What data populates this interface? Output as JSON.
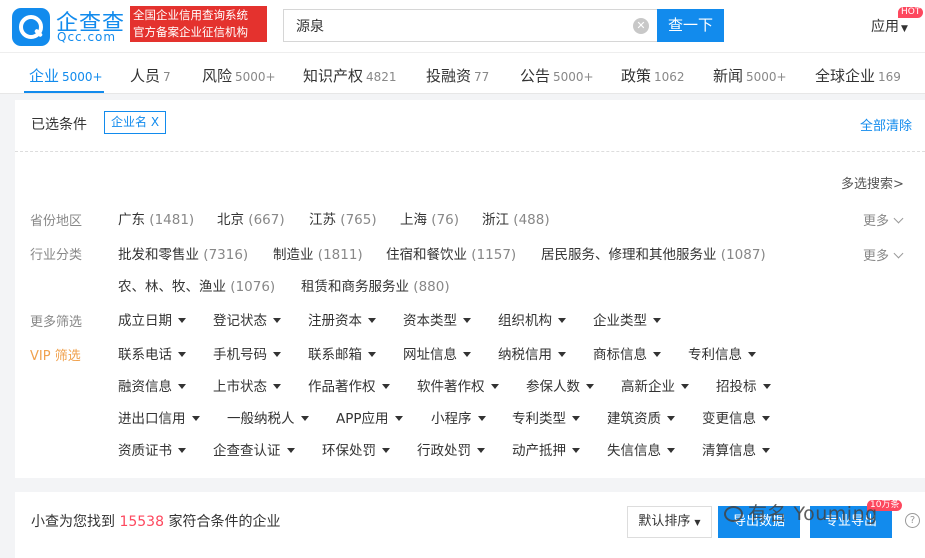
{
  "header": {
    "brand_cn": "企查查",
    "brand_en": "Qcc.com",
    "slogan_line1": "全国企业信用查询系统",
    "slogan_line2": "官方备案企业征信机构",
    "search_value": "源泉",
    "search_button": "查一下",
    "apps_label": "应用",
    "hot_badge": "HOT"
  },
  "tabs": [
    {
      "label": "企业",
      "count": "5000+"
    },
    {
      "label": "人员",
      "count": "7"
    },
    {
      "label": "风险",
      "count": "5000+"
    },
    {
      "label": "知识产权",
      "count": "4821"
    },
    {
      "label": "投融资",
      "count": "77"
    },
    {
      "label": "公告",
      "count": "5000+"
    },
    {
      "label": "政策",
      "count": "1062"
    },
    {
      "label": "新闻",
      "count": "5000+"
    },
    {
      "label": "全球企业",
      "count": "169"
    }
  ],
  "filters": {
    "selected_label": "已选条件",
    "selected_chip": "企业名 X",
    "clear_all": "全部清除",
    "multi_search": "多选搜索>",
    "more_label": "更多",
    "province": {
      "label": "省份地区",
      "options": [
        {
          "name": "广东",
          "count": "(1481)"
        },
        {
          "name": "北京",
          "count": "(667)"
        },
        {
          "name": "江苏",
          "count": "(765)"
        },
        {
          "name": "上海",
          "count": "(76)"
        },
        {
          "name": "浙江",
          "count": "(488)"
        }
      ]
    },
    "industry": {
      "label": "行业分类",
      "options": [
        {
          "name": "批发和零售业",
          "count": "(7316)"
        },
        {
          "name": "制造业",
          "count": "(1811)"
        },
        {
          "name": "住宿和餐饮业",
          "count": "(1157)"
        },
        {
          "name": "居民服务、修理和其他服务业",
          "count": "(1087)"
        },
        {
          "name": "农、林、牧、渔业",
          "count": "(1076)"
        },
        {
          "name": "租赁和商务服务业",
          "count": "(880)"
        }
      ]
    },
    "more_filters": {
      "label": "更多筛选",
      "items": [
        "成立日期",
        "登记状态",
        "注册资本",
        "资本类型",
        "组织机构",
        "企业类型"
      ]
    },
    "vip_filters": {
      "label": "VIP 筛选",
      "rows": [
        [
          "联系电话",
          "手机号码",
          "联系邮箱",
          "网址信息",
          "纳税信用",
          "商标信息",
          "专利信息"
        ],
        [
          "融资信息",
          "上市状态",
          "作品著作权",
          "软件著作权",
          "参保人数",
          "高新企业",
          "招投标"
        ],
        [
          "进出口信用",
          "一般纳税人",
          "APP应用",
          "小程序",
          "专利类型",
          "建筑资质",
          "变更信息"
        ],
        [
          "资质证书",
          "企查查认证",
          "环保处罚",
          "行政处罚",
          "动产抵押",
          "失信信息",
          "清算信息"
        ]
      ]
    }
  },
  "result": {
    "prefix": "小查为您找到",
    "count": "15538",
    "suffix": "家符合条件的企业",
    "sort_label": "默认排序",
    "export_label": "导出数据",
    "export_pro_label": "专业导出",
    "badge_10w": "10万条",
    "watermark": "有名 Youming"
  },
  "colors": {
    "brand_blue": "#128bed",
    "slogan_red": "#e4322e",
    "count_red": "#fd485e",
    "vip_orange": "#f0a14d"
  }
}
